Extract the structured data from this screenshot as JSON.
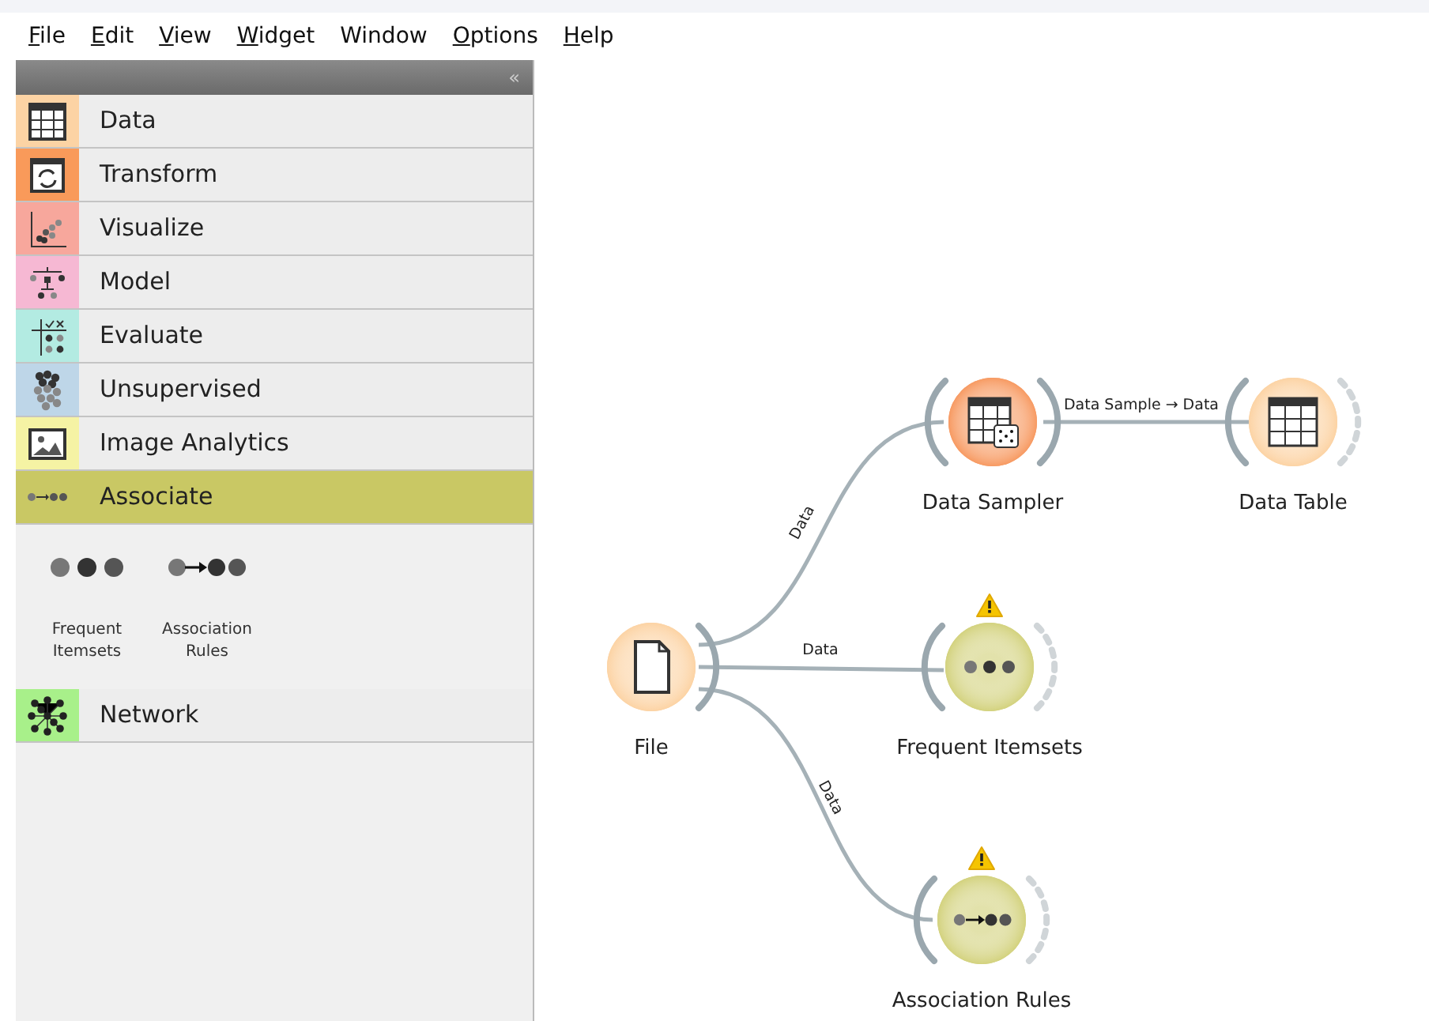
{
  "menu": [
    {
      "label": "File",
      "underline": true
    },
    {
      "label": "Edit",
      "underline": true
    },
    {
      "label": "View",
      "underline": true
    },
    {
      "label": "Widget",
      "underline": true
    },
    {
      "label": "Window",
      "underline": false
    },
    {
      "label": "Options",
      "underline": true
    },
    {
      "label": "Help",
      "underline": true
    }
  ],
  "sidebar": {
    "collapse": "«",
    "categories": [
      {
        "label": "Data",
        "kind": "table",
        "color": "#fcd3a4",
        "selected": false
      },
      {
        "label": "Transform",
        "kind": "transform",
        "color": "#f99a5a",
        "selected": false
      },
      {
        "label": "Visualize",
        "kind": "scatter",
        "color": "#f7a79c",
        "selected": false
      },
      {
        "label": "Model",
        "kind": "tree",
        "color": "#f6b8d3",
        "selected": false
      },
      {
        "label": "Evaluate",
        "kind": "evaluate",
        "color": "#b3ebe2",
        "selected": false
      },
      {
        "label": "Unsupervised",
        "kind": "cluster",
        "color": "#bed6e8",
        "selected": false
      },
      {
        "label": "Image Analytics",
        "kind": "image",
        "color": "#f5f3a4",
        "selected": false
      },
      {
        "label": "Associate",
        "kind": "associate",
        "color": "#c9c864",
        "selected": true,
        "widgets": [
          {
            "label": "Frequent Itemsets",
            "kind": "dots"
          },
          {
            "label": "Association Rules",
            "kind": "rules"
          }
        ]
      },
      {
        "label": "Network",
        "kind": "network",
        "color": "#a8f08a",
        "selected": false
      }
    ]
  },
  "canvas": {
    "nodes": [
      {
        "label": "Data Sampler",
        "kind": "sampler",
        "color": "#f79a62",
        "warning": false,
        "open_output": false
      },
      {
        "label": "Data Table",
        "kind": "table",
        "color": "#fcd3a4",
        "warning": false,
        "open_output": true
      },
      {
        "label": "File",
        "kind": "file",
        "color": "#fcd3a4",
        "warning": false,
        "open_output": false
      },
      {
        "label": "Frequent Itemsets",
        "kind": "dots",
        "color": "#d3d27e",
        "warning": true,
        "open_output": true
      },
      {
        "label": "Association Rules",
        "kind": "rules",
        "color": "#d3d27e",
        "warning": true,
        "open_output": true
      }
    ],
    "links": [
      {
        "label": "Data Sample → Data"
      },
      {
        "label": "Data"
      },
      {
        "label": "Data"
      },
      {
        "label": "Data"
      }
    ]
  }
}
